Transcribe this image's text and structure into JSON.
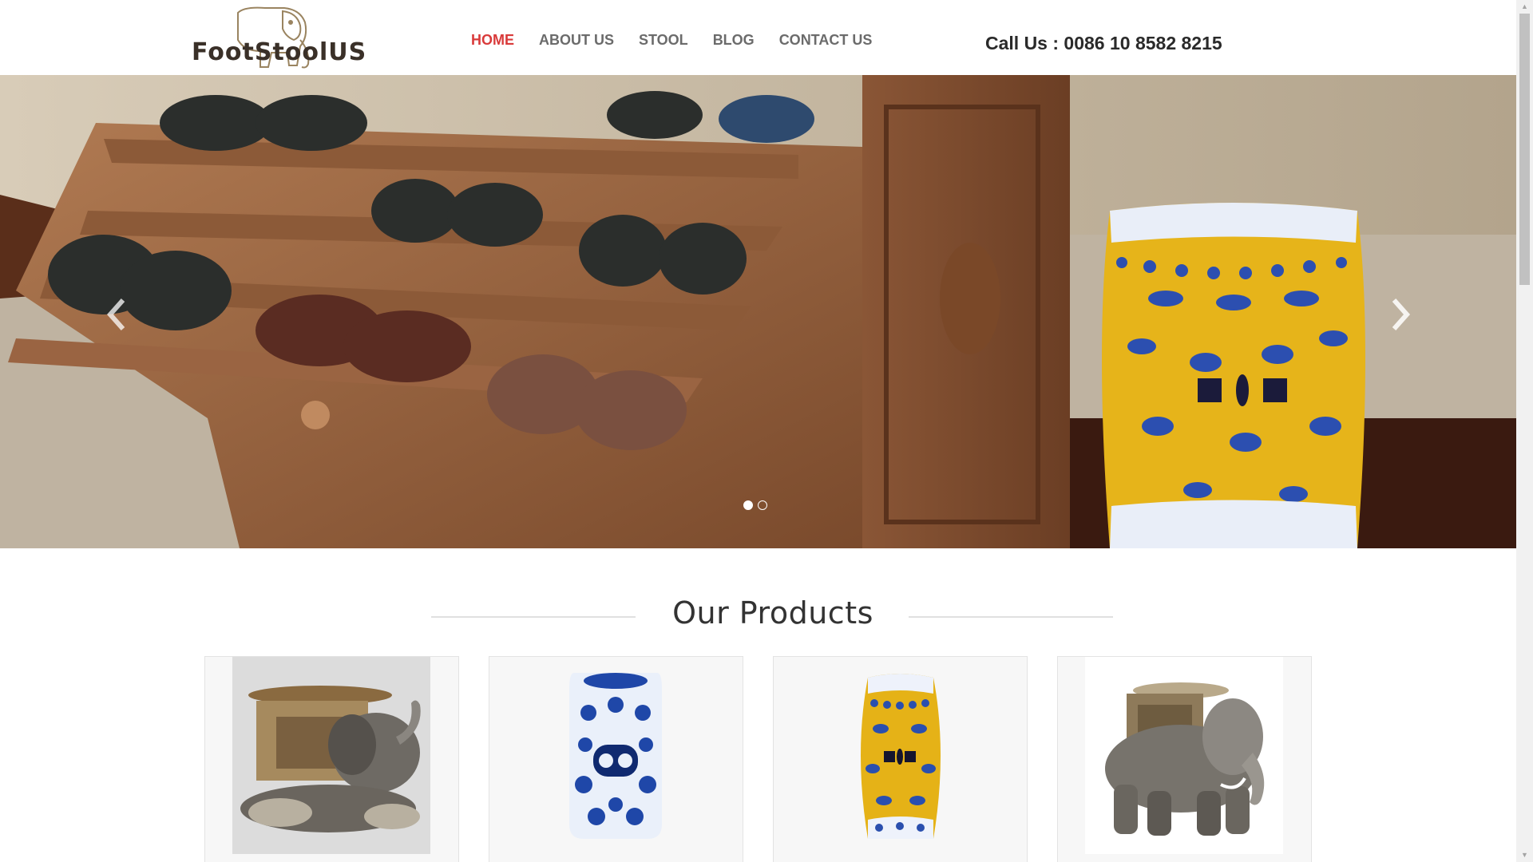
{
  "header": {
    "logo_text": "FootStoolUS",
    "nav": [
      {
        "label": "HOME",
        "active": true
      },
      {
        "label": "ABOUT US",
        "active": false
      },
      {
        "label": "STOOL",
        "active": false
      },
      {
        "label": "BLOG",
        "active": false
      },
      {
        "label": "CONTACT US",
        "active": false
      }
    ],
    "call_text": "Call Us : 0086 10 8582 8215"
  },
  "slider": {
    "slide_count": 2,
    "active_slide": 1,
    "prev_icon": "chevron-left-icon",
    "next_icon": "chevron-right-icon"
  },
  "products_section": {
    "title": "Our Products",
    "items": [
      {
        "image": "elephant-stool-reclining"
      },
      {
        "image": "blue-white-porcelain-stool"
      },
      {
        "image": "yellow-blue-porcelain-stool"
      },
      {
        "image": "elephant-stool-standing"
      }
    ]
  },
  "colors": {
    "nav_active": "#d93a3a",
    "nav_default": "#6b6b6b",
    "text_dark": "#2a2a2a"
  }
}
